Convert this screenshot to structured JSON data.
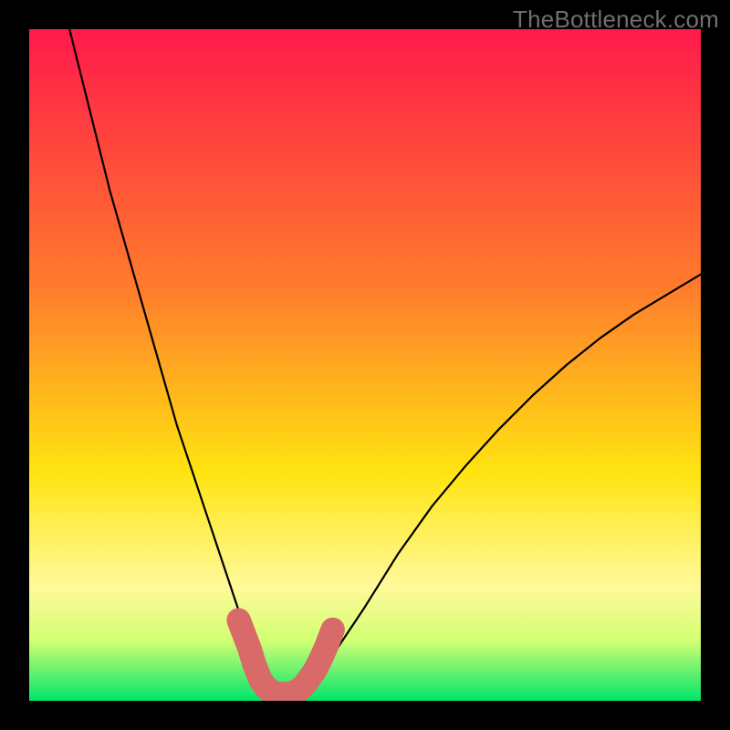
{
  "watermark": "TheBottleneck.com",
  "colors": {
    "frame": "#000000",
    "grad_top": "#ff1a4b",
    "grad_mid1": "#ff7a2c",
    "grad_mid2": "#ffe411",
    "grad_low": "#fff99a",
    "grad_band": "#d3ff74",
    "grad_bottom": "#00e56a",
    "curve": "#000000",
    "markers": "#d86a6a"
  },
  "chart_data": {
    "type": "line",
    "title": "",
    "xlabel": "",
    "ylabel": "",
    "xlim": [
      0,
      100
    ],
    "ylim": [
      0,
      100
    ],
    "series": [
      {
        "name": "bottleneck-curve",
        "x": [
          6,
          8,
          10,
          12,
          14,
          16,
          18,
          20,
          22,
          24,
          26,
          28,
          30,
          31,
          32,
          33,
          34,
          35,
          36,
          37,
          38,
          39,
          40,
          42,
          44,
          46,
          50,
          55,
          60,
          65,
          70,
          75,
          80,
          85,
          90,
          95,
          100
        ],
        "y": [
          100,
          92,
          84,
          76,
          69,
          62,
          55,
          48,
          41,
          35,
          29,
          23,
          17,
          14,
          11,
          8,
          5.5,
          3.3,
          2,
          1.3,
          1,
          1,
          1.3,
          2.5,
          5,
          8,
          14,
          22,
          29,
          35,
          40.5,
          45.5,
          50,
          54,
          57.5,
          60.5,
          63.5
        ]
      }
    ],
    "markers": [
      {
        "x": 31.2,
        "y": 12.0,
        "r": 1.3
      },
      {
        "x": 32.8,
        "y": 7.8,
        "r": 1.4
      },
      {
        "x": 33.6,
        "y": 5.2,
        "r": 1.6
      },
      {
        "x": 34.4,
        "y": 3.2,
        "r": 1.7
      },
      {
        "x": 35.4,
        "y": 1.8,
        "r": 1.7
      },
      {
        "x": 36.6,
        "y": 1.1,
        "r": 1.7
      },
      {
        "x": 37.8,
        "y": 1.0,
        "r": 1.7
      },
      {
        "x": 39.0,
        "y": 1.1,
        "r": 1.7
      },
      {
        "x": 40.2,
        "y": 1.6,
        "r": 1.7
      },
      {
        "x": 41.2,
        "y": 2.6,
        "r": 1.6
      },
      {
        "x": 42.6,
        "y": 4.6,
        "r": 1.5
      },
      {
        "x": 43.4,
        "y": 6.2,
        "r": 1.5
      },
      {
        "x": 44.2,
        "y": 8.0,
        "r": 1.4
      },
      {
        "x": 45.2,
        "y": 10.6,
        "r": 1.1
      }
    ],
    "marker_path_width": 3.6
  }
}
